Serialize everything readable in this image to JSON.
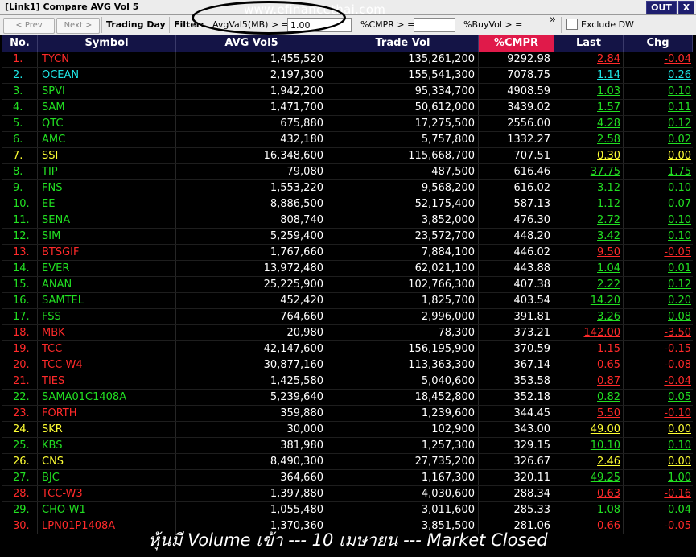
{
  "window": {
    "title": "[Link1] Compare AVG Vol 5",
    "out_label": "OUT",
    "close_label": "X"
  },
  "toolbar": {
    "prev_label": "< Prev",
    "next_label": "Next >",
    "trading_day_label": "Trading Day",
    "filter_label": "Filter:",
    "avgvol_label": "AvgVal5(MB) > =",
    "avgvol_value": "1.00",
    "cmpr_label": "%CMPR > =",
    "cmpr_value": "",
    "buyvol_label": "%BuyVol > =",
    "more_label": "»",
    "exclude_label": "Exclude DW"
  },
  "watermark": "www.efinancethai.com",
  "colors": {
    "red": "#ff2a2a",
    "cyan": "#1fe6e6",
    "green": "#22e022",
    "yellow": "#ffff33",
    "header_bg": "#141446",
    "sorted_bg": "#e01a4a"
  },
  "table": {
    "columns": [
      "No.",
      "Symbol",
      "AVG Vol5",
      "Trade Vol",
      "%CMPR",
      "Last",
      "Chg"
    ],
    "rows": [
      {
        "no": "1.",
        "symbol": "TYCN",
        "avg": "1,455,520",
        "tv": "135,261,200",
        "cmpr": "9292.98",
        "last": "2.84",
        "chg": "-0.04",
        "color": "red"
      },
      {
        "no": "2.",
        "symbol": "OCEAN",
        "avg": "2,197,300",
        "tv": "155,541,300",
        "cmpr": "7078.75",
        "last": "1.14",
        "chg": "0.26",
        "color": "cyan"
      },
      {
        "no": "3.",
        "symbol": "SPVI",
        "avg": "1,942,200",
        "tv": "95,334,700",
        "cmpr": "4908.59",
        "last": "1.03",
        "chg": "0.10",
        "color": "green"
      },
      {
        "no": "4.",
        "symbol": "SAM",
        "avg": "1,471,700",
        "tv": "50,612,000",
        "cmpr": "3439.02",
        "last": "1.57",
        "chg": "0.11",
        "color": "green"
      },
      {
        "no": "5.",
        "symbol": "QTC",
        "avg": "675,880",
        "tv": "17,275,500",
        "cmpr": "2556.00",
        "last": "4.28",
        "chg": "0.12",
        "color": "green"
      },
      {
        "no": "6.",
        "symbol": "AMC",
        "avg": "432,180",
        "tv": "5,757,800",
        "cmpr": "1332.27",
        "last": "2.58",
        "chg": "0.02",
        "color": "green"
      },
      {
        "no": "7.",
        "symbol": "SSI",
        "avg": "16,348,600",
        "tv": "115,668,700",
        "cmpr": "707.51",
        "last": "0.30",
        "chg": "0.00",
        "color": "yellow"
      },
      {
        "no": "8.",
        "symbol": "TIP",
        "avg": "79,080",
        "tv": "487,500",
        "cmpr": "616.46",
        "last": "37.75",
        "chg": "1.75",
        "color": "green"
      },
      {
        "no": "9.",
        "symbol": "FNS",
        "avg": "1,553,220",
        "tv": "9,568,200",
        "cmpr": "616.02",
        "last": "3.12",
        "chg": "0.10",
        "color": "green"
      },
      {
        "no": "10.",
        "symbol": "EE",
        "avg": "8,886,500",
        "tv": "52,175,400",
        "cmpr": "587.13",
        "last": "1.12",
        "chg": "0.07",
        "color": "green"
      },
      {
        "no": "11.",
        "symbol": "SENA",
        "avg": "808,740",
        "tv": "3,852,000",
        "cmpr": "476.30",
        "last": "2.72",
        "chg": "0.10",
        "color": "green"
      },
      {
        "no": "12.",
        "symbol": "SIM",
        "avg": "5,259,400",
        "tv": "23,572,700",
        "cmpr": "448.20",
        "last": "3.42",
        "chg": "0.10",
        "color": "green"
      },
      {
        "no": "13.",
        "symbol": "BTSGIF",
        "avg": "1,767,660",
        "tv": "7,884,100",
        "cmpr": "446.02",
        "last": "9.50",
        "chg": "-0.05",
        "color": "red"
      },
      {
        "no": "14.",
        "symbol": "EVER",
        "avg": "13,972,480",
        "tv": "62,021,100",
        "cmpr": "443.88",
        "last": "1.04",
        "chg": "0.01",
        "color": "green"
      },
      {
        "no": "15.",
        "symbol": "ANAN",
        "avg": "25,225,900",
        "tv": "102,766,300",
        "cmpr": "407.38",
        "last": "2.22",
        "chg": "0.12",
        "color": "green"
      },
      {
        "no": "16.",
        "symbol": "SAMTEL",
        "avg": "452,420",
        "tv": "1,825,700",
        "cmpr": "403.54",
        "last": "14.20",
        "chg": "0.20",
        "color": "green"
      },
      {
        "no": "17.",
        "symbol": "FSS",
        "avg": "764,660",
        "tv": "2,996,000",
        "cmpr": "391.81",
        "last": "3.26",
        "chg": "0.08",
        "color": "green"
      },
      {
        "no": "18.",
        "symbol": "MBK",
        "avg": "20,980",
        "tv": "78,300",
        "cmpr": "373.21",
        "last": "142.00",
        "chg": "-3.50",
        "color": "red"
      },
      {
        "no": "19.",
        "symbol": "TCC",
        "avg": "42,147,600",
        "tv": "156,195,900",
        "cmpr": "370.59",
        "last": "1.15",
        "chg": "-0.15",
        "color": "red"
      },
      {
        "no": "20.",
        "symbol": "TCC-W4",
        "avg": "30,877,160",
        "tv": "113,363,300",
        "cmpr": "367.14",
        "last": "0.65",
        "chg": "-0.08",
        "color": "red"
      },
      {
        "no": "21.",
        "symbol": "TIES",
        "avg": "1,425,580",
        "tv": "5,040,600",
        "cmpr": "353.58",
        "last": "0.87",
        "chg": "-0.04",
        "color": "red"
      },
      {
        "no": "22.",
        "symbol": "SAMA01C1408A",
        "avg": "5,239,640",
        "tv": "18,452,800",
        "cmpr": "352.18",
        "last": "0.82",
        "chg": "0.05",
        "color": "green"
      },
      {
        "no": "23.",
        "symbol": "FORTH",
        "avg": "359,880",
        "tv": "1,239,600",
        "cmpr": "344.45",
        "last": "5.50",
        "chg": "-0.10",
        "color": "red"
      },
      {
        "no": "24.",
        "symbol": "SKR",
        "avg": "30,000",
        "tv": "102,900",
        "cmpr": "343.00",
        "last": "49.00",
        "chg": "0.00",
        "color": "yellow"
      },
      {
        "no": "25.",
        "symbol": "KBS",
        "avg": "381,980",
        "tv": "1,257,300",
        "cmpr": "329.15",
        "last": "10.10",
        "chg": "0.10",
        "color": "green"
      },
      {
        "no": "26.",
        "symbol": "CNS",
        "avg": "8,490,300",
        "tv": "27,735,200",
        "cmpr": "326.67",
        "last": "2.46",
        "chg": "0.00",
        "color": "yellow"
      },
      {
        "no": "27.",
        "symbol": "BJC",
        "avg": "364,660",
        "tv": "1,167,300",
        "cmpr": "320.11",
        "last": "49.25",
        "chg": "1.00",
        "color": "green"
      },
      {
        "no": "28.",
        "symbol": "TCC-W3",
        "avg": "1,397,880",
        "tv": "4,030,600",
        "cmpr": "288.34",
        "last": "0.63",
        "chg": "-0.16",
        "color": "red"
      },
      {
        "no": "29.",
        "symbol": "CHO-W1",
        "avg": "1,055,480",
        "tv": "3,011,600",
        "cmpr": "285.33",
        "last": "1.08",
        "chg": "0.04",
        "color": "green"
      },
      {
        "no": "30.",
        "symbol": "LPN01P1408A",
        "avg": "1,370,360",
        "tv": "3,851,500",
        "cmpr": "281.06",
        "last": "0.66",
        "chg": "-0.05",
        "color": "red"
      }
    ]
  },
  "footer": "หุ้นมี Volume เข้า --- 10 เมษายน --- Market Closed"
}
